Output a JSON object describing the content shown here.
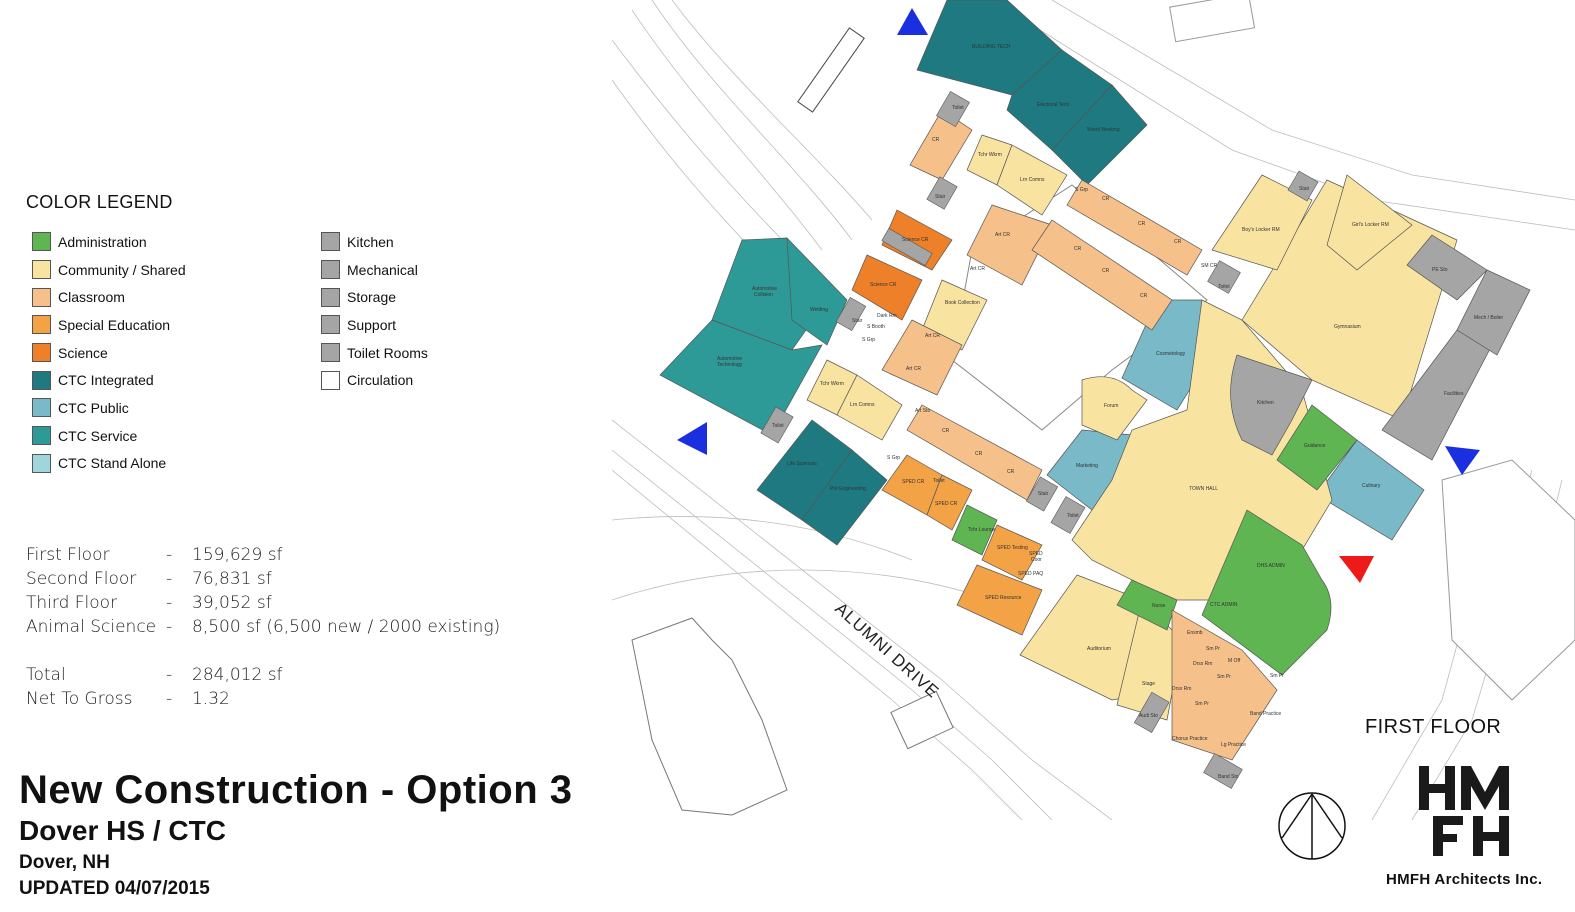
{
  "legend": {
    "title": "COLOR LEGEND",
    "items_left": [
      {
        "label": "Administration",
        "color": "#5fb552"
      },
      {
        "label": "Community / Shared",
        "color": "#f8e3a0"
      },
      {
        "label": "Classroom",
        "color": "#f5c08a"
      },
      {
        "label": "Special Education",
        "color": "#f3a246"
      },
      {
        "label": "Science",
        "color": "#ed8028"
      },
      {
        "label": "CTC Integrated",
        "color": "#1e7a80"
      },
      {
        "label": "CTC Public",
        "color": "#79b9c8"
      },
      {
        "label": "CTC Service",
        "color": "#2e9a98"
      },
      {
        "label": "CTC Stand Alone",
        "color": "#9fd6db"
      }
    ],
    "items_right": [
      {
        "label": "Kitchen",
        "color": "#a5a5a5"
      },
      {
        "label": "Mechanical",
        "color": "#a5a5a5"
      },
      {
        "label": "Storage",
        "color": "#a5a5a5"
      },
      {
        "label": "Support",
        "color": "#a5a5a5"
      },
      {
        "label": "Toilet Rooms",
        "color": "#a5a5a5"
      },
      {
        "label": "Circulation",
        "color": "#ffffff"
      }
    ]
  },
  "stats": {
    "rows": [
      {
        "label": "First Floor",
        "dash": "-",
        "value": "159,629 sf"
      },
      {
        "label": "Second Floor",
        "dash": "-",
        "value": "76,831 sf"
      },
      {
        "label": "Third Floor",
        "dash": "-",
        "value": "39,052 sf"
      },
      {
        "label": "Animal Science",
        "dash": "-",
        "value": "8,500 sf (6,500 new / 2000 existing)"
      }
    ],
    "totals": [
      {
        "label": "Total",
        "dash": "-",
        "value": "284,012 sf"
      },
      {
        "label": "Net To Gross",
        "dash": "-",
        "value": "1.32"
      }
    ]
  },
  "title": {
    "main": "New Construction - Option 3",
    "sub": "Dover HS / CTC",
    "city": "Dover, NH",
    "updated": "UPDATED 04/07/2015"
  },
  "plan": {
    "floor_label": "FIRST FLOOR",
    "road_label": "ALUMNI DRIVE",
    "firm": "HMFH Architects Inc.",
    "rooms": [
      {
        "name": "BUILDING TECH",
        "cat": "CTC Integrated"
      },
      {
        "name": "Electrical Tech",
        "cat": "CTC Integrated"
      },
      {
        "name": "Wood Working",
        "cat": "CTC Integrated"
      },
      {
        "name": "Automotive Collision",
        "cat": "CTC Service"
      },
      {
        "name": "Automotive Technology",
        "cat": "CTC Service"
      },
      {
        "name": "Welding",
        "cat": "CTC Service"
      },
      {
        "name": "Life Sciences",
        "cat": "CTC Integrated"
      },
      {
        "name": "Pre Engineering",
        "cat": "CTC Integrated"
      },
      {
        "name": "Cosmetology",
        "cat": "CTC Public"
      },
      {
        "name": "Marketing",
        "cat": "CTC Public"
      },
      {
        "name": "Culinary",
        "cat": "CTC Public"
      },
      {
        "name": "Science CR",
        "cat": "Science"
      },
      {
        "name": "Science CR",
        "cat": "Science"
      },
      {
        "name": "SPED CR",
        "cat": "Special Education"
      },
      {
        "name": "SPED CR",
        "cat": "Special Education"
      },
      {
        "name": "SPED Testing",
        "cat": "Special Education"
      },
      {
        "name": "SPED Coor",
        "cat": "Special Education"
      },
      {
        "name": "SPED PAQ",
        "cat": "Special Education"
      },
      {
        "name": "SPED Resource",
        "cat": "Special Education"
      },
      {
        "name": "Tchr Lounge",
        "cat": "Administration"
      },
      {
        "name": "Guidance",
        "cat": "Administration"
      },
      {
        "name": "DHS ADMIN",
        "cat": "Administration"
      },
      {
        "name": "CTC ADMIN",
        "cat": "Administration"
      },
      {
        "name": "Nurse",
        "cat": "Administration"
      },
      {
        "name": "TOWN HALL",
        "cat": "Community / Shared"
      },
      {
        "name": "Gymnasium",
        "cat": "Community / Shared"
      },
      {
        "name": "Boy's Locker RM",
        "cat": "Community / Shared"
      },
      {
        "name": "Girl's Locker RM",
        "cat": "Community / Shared"
      },
      {
        "name": "Auditorium",
        "cat": "Community / Shared"
      },
      {
        "name": "Forum",
        "cat": "Community / Shared"
      },
      {
        "name": "Stage",
        "cat": "Community / Shared"
      },
      {
        "name": "Book Collection",
        "cat": "Community / Shared"
      },
      {
        "name": "Tchr Wkrm",
        "cat": "Community / Shared"
      },
      {
        "name": "Lrn Comns",
        "cat": "Community / Shared"
      },
      {
        "name": "Tchr Wkrm",
        "cat": "Community / Shared"
      },
      {
        "name": "Lrn Comns",
        "cat": "Community / Shared"
      },
      {
        "name": "Kitchen",
        "cat": "Kitchen"
      },
      {
        "name": "Facilities",
        "cat": "Support"
      },
      {
        "name": "Mech / Boiler",
        "cat": "Mechanical"
      },
      {
        "name": "PE Sto",
        "cat": "Storage"
      },
      {
        "name": "Band Practice",
        "cat": "Classroom"
      },
      {
        "name": "Chorus Practice",
        "cat": "Classroom"
      },
      {
        "name": "Lg Practice",
        "cat": "Classroom"
      },
      {
        "name": "Ensmb",
        "cat": "Classroom"
      },
      {
        "name": "Sm Pr",
        "cat": "Classroom"
      },
      {
        "name": "M Off",
        "cat": "Classroom"
      },
      {
        "name": "Drss Rm",
        "cat": "Classroom"
      },
      {
        "name": "Band Sto",
        "cat": "Storage"
      },
      {
        "name": "Audi Sto",
        "cat": "Storage"
      },
      {
        "name": "CR",
        "cat": "Classroom"
      },
      {
        "name": "Art CR",
        "cat": "Classroom"
      },
      {
        "name": "Art Sto",
        "cat": "Classroom"
      },
      {
        "name": "SM CR",
        "cat": "Classroom"
      },
      {
        "name": "S Grp",
        "cat": "Classroom"
      },
      {
        "name": "Dark Rm",
        "cat": "Classroom"
      },
      {
        "name": "S Booth",
        "cat": "Classroom"
      },
      {
        "name": "Toilet",
        "cat": "Toilet Rooms"
      },
      {
        "name": "Stair",
        "cat": "Support"
      }
    ]
  }
}
